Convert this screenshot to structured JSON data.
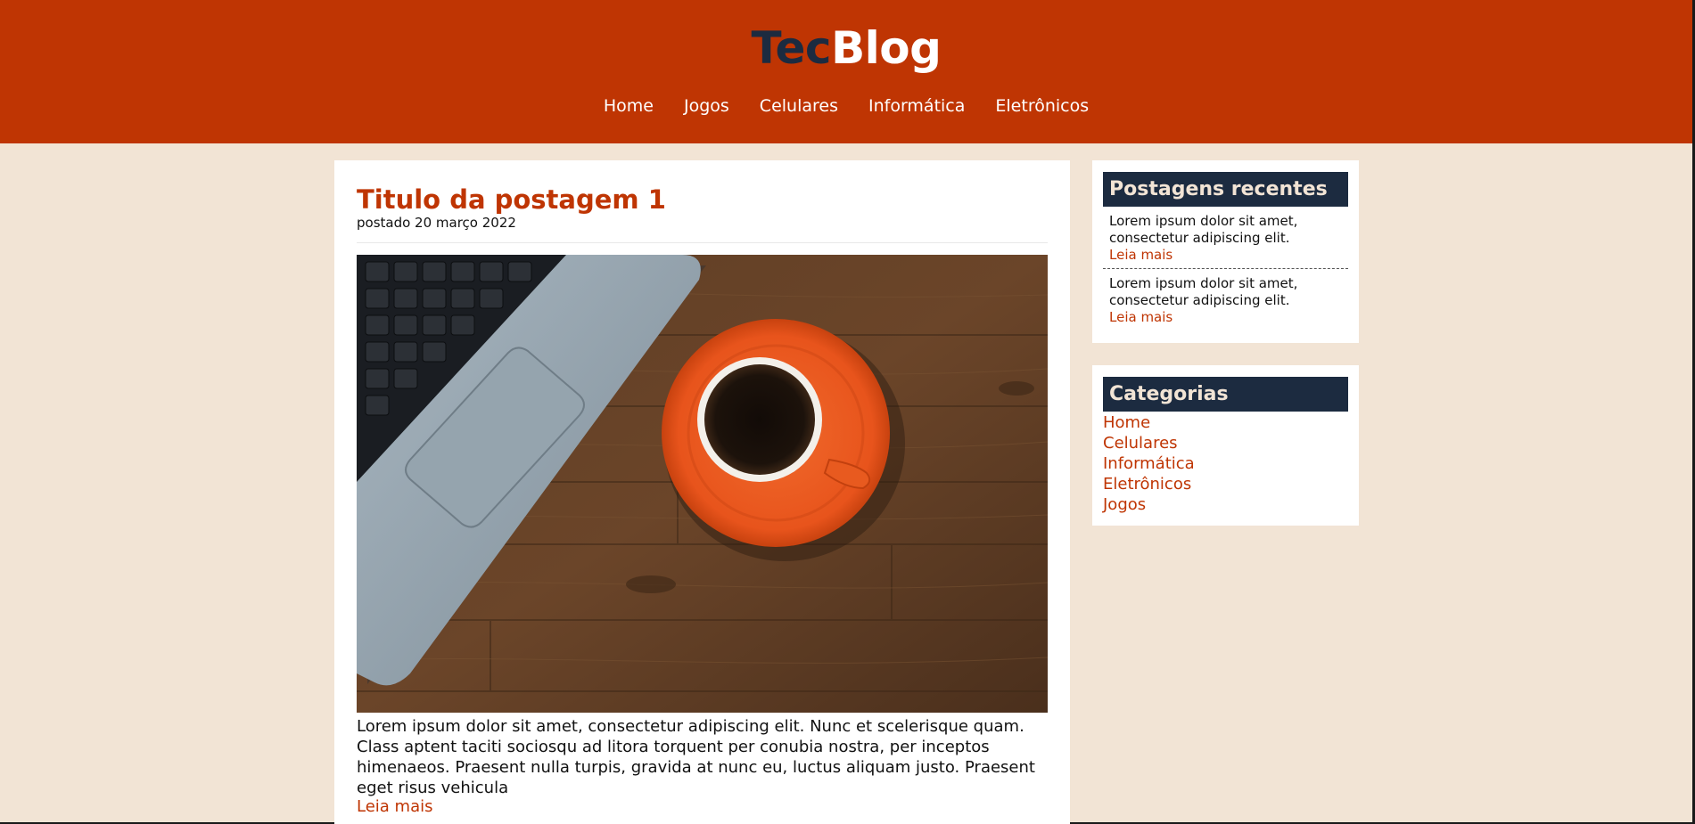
{
  "header": {
    "logo_part1": "Tec",
    "logo_part2": "Blog",
    "nav": [
      "Home",
      "Jogos",
      "Celulares",
      "Informática",
      "Eletrônicos"
    ],
    "background_color": "#bf3503",
    "logo_dark_color": "#1c2b40"
  },
  "post": {
    "title": "Titulo da postagem 1",
    "date": "postado 20 março 2022",
    "image_alt": "laptop and orange coffee cup on wooden desk",
    "text": "Lorem ipsum dolor sit amet, consectetur adipiscing elit. Nunc et scelerisque quam. Class aptent taciti sociosqu ad litora torquent per conubia nostra, per inceptos himenaeos. Praesent nulla turpis, gravida at nunc eu, luctus aliquam justo. Praesent eget risus vehicula",
    "read_more": "Leia mais"
  },
  "sidebar": {
    "recent": {
      "title": "Postagens recentes",
      "items": [
        {
          "text": "Lorem ipsum dolor sit amet, consectetur adipiscing elit.",
          "read_more": "Leia mais"
        },
        {
          "text": "Lorem ipsum dolor sit amet, consectetur adipiscing elit.",
          "read_more": "Leia mais"
        }
      ]
    },
    "categories": {
      "title": "Categorias",
      "items": [
        "Home",
        "Celulares",
        "Informática",
        "Eletrônicos",
        "Jogos"
      ]
    }
  },
  "colors": {
    "page_background": "#f2e4d5",
    "accent": "#bf3503",
    "widget_header": "#1c2b40"
  }
}
